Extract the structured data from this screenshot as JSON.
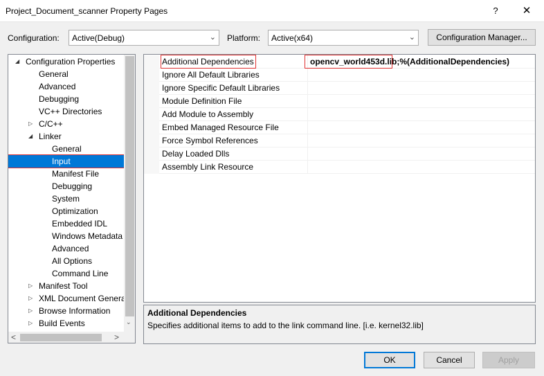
{
  "window": {
    "title": "Project_Document_scanner Property Pages",
    "help_glyph": "?",
    "close_glyph": "✕"
  },
  "toolbar": {
    "configuration_label": "Configuration:",
    "configuration_value": "Active(Debug)",
    "platform_label": "Platform:",
    "platform_value": "Active(x64)",
    "config_manager_label": "Configuration Manager..."
  },
  "tree": {
    "items": [
      {
        "label": "Configuration Properties",
        "expander": "◢"
      },
      {
        "label": "General"
      },
      {
        "label": "Advanced"
      },
      {
        "label": "Debugging"
      },
      {
        "label": "VC++ Directories"
      },
      {
        "label": "C/C++",
        "expander": "▷"
      },
      {
        "label": "Linker",
        "expander": "◢"
      },
      {
        "label": "General"
      },
      {
        "label": "Input",
        "selected": true
      },
      {
        "label": "Manifest File"
      },
      {
        "label": "Debugging"
      },
      {
        "label": "System"
      },
      {
        "label": "Optimization"
      },
      {
        "label": "Embedded IDL"
      },
      {
        "label": "Windows Metadata"
      },
      {
        "label": "Advanced"
      },
      {
        "label": "All Options"
      },
      {
        "label": "Command Line"
      },
      {
        "label": "Manifest Tool",
        "expander": "▷"
      },
      {
        "label": "XML Document Genera",
        "expander": "▷"
      },
      {
        "label": "Browse Information",
        "expander": "▷"
      },
      {
        "label": "Build Events",
        "expander": "▷"
      }
    ],
    "scroll_down": "⌄",
    "scroll_left": "<",
    "scroll_right": ">"
  },
  "properties": {
    "rows": [
      {
        "name": "Additional Dependencies",
        "value": "opencv_world453d.lib;%(AdditionalDependencies)"
      },
      {
        "name": "Ignore All Default Libraries",
        "value": ""
      },
      {
        "name": "Ignore Specific Default Libraries",
        "value": ""
      },
      {
        "name": "Module Definition File",
        "value": ""
      },
      {
        "name": "Add Module to Assembly",
        "value": ""
      },
      {
        "name": "Embed Managed Resource File",
        "value": ""
      },
      {
        "name": "Force Symbol References",
        "value": ""
      },
      {
        "name": "Delay Loaded Dlls",
        "value": ""
      },
      {
        "name": "Assembly Link Resource",
        "value": ""
      }
    ]
  },
  "description": {
    "title": "Additional Dependencies",
    "body": "Specifies additional items to add to the link command line. [i.e. kernel32.lib]"
  },
  "buttons": {
    "ok": "OK",
    "cancel": "Cancel",
    "apply": "Apply"
  },
  "colors": {
    "selection": "#0078d7",
    "highlight_box": "#e03030"
  }
}
